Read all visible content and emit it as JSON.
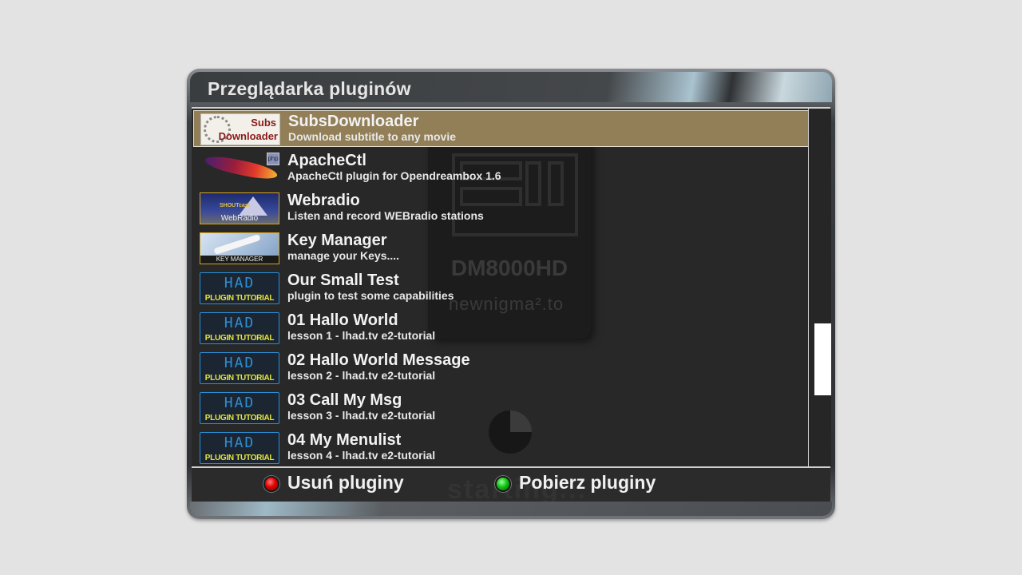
{
  "window": {
    "title": "Przeglądarka pluginów"
  },
  "background": {
    "model": "DM8000HD",
    "brand": "newnigma².to",
    "status": "starting..."
  },
  "plugins": [
    {
      "name": "SubsDownloader",
      "description": "Download subtitle to any movie",
      "thumbnail": "subs-downloader",
      "thumb_text": [
        "Subs",
        "Downloader"
      ],
      "selected": true
    },
    {
      "name": "ApacheCtl",
      "description": "ApacheCtl plugin for Opendreambox 1.6",
      "thumbnail": "apache-feather",
      "thumb_text": [
        "php"
      ]
    },
    {
      "name": "Webradio",
      "description": "Listen and record WEBradio stations",
      "thumbnail": "webradio",
      "thumb_text": [
        "WebRadio",
        "SHOUTcast"
      ]
    },
    {
      "name": "Key Manager",
      "description": "manage your Keys....",
      "thumbnail": "key-manager",
      "thumb_text": [
        "KEY MANAGER"
      ]
    },
    {
      "name": "Our Small Test",
      "description": "plugin to test some capabilities",
      "thumbnail": "plugin-tutorial",
      "thumb_text": [
        "HAD",
        "PLUGIN TUTORIAL"
      ]
    },
    {
      "name": "01 Hallo World",
      "description": "lesson 1 - lhad.tv e2-tutorial",
      "thumbnail": "plugin-tutorial",
      "thumb_text": [
        "HAD",
        "PLUGIN TUTORIAL"
      ]
    },
    {
      "name": "02 Hallo World Message",
      "description": "lesson 2 - lhad.tv e2-tutorial",
      "thumbnail": "plugin-tutorial",
      "thumb_text": [
        "HAD",
        "PLUGIN TUTORIAL"
      ]
    },
    {
      "name": "03 Call My Msg",
      "description": "lesson 3 - lhad.tv e2-tutorial",
      "thumbnail": "plugin-tutorial",
      "thumb_text": [
        "HAD",
        "PLUGIN TUTORIAL"
      ]
    },
    {
      "name": "04 My Menulist",
      "description": "lesson 4 - lhad.tv e2-tutorial",
      "thumbnail": "plugin-tutorial",
      "thumb_text": [
        "HAD",
        "PLUGIN TUTORIAL"
      ]
    }
  ],
  "buttons": {
    "red": {
      "label": "Usuń pluginy",
      "icon": "red-button-icon",
      "color": "#e00000"
    },
    "green": {
      "label": "Pobierz pluginy",
      "icon": "green-button-icon",
      "color": "#13c513"
    }
  },
  "scroll": {
    "position_fraction": 0.6,
    "visible_fraction": 0.2
  },
  "colors": {
    "selection": "#927f58",
    "list_background": "#282828",
    "page_background": "#e3e3e3"
  }
}
